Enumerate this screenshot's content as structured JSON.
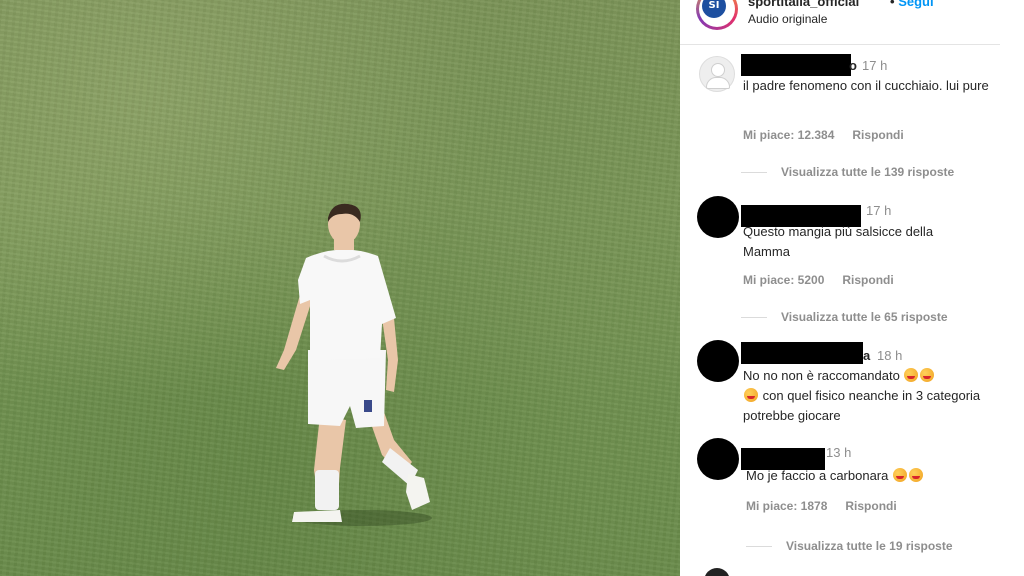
{
  "header": {
    "username": "sportitalia_official",
    "separator": "•",
    "follow_label": "Segui",
    "audio_label": "Audio originale",
    "logo_text": "SI"
  },
  "comments": [
    {
      "name_tail": "o",
      "time": "17 h",
      "text": "il padre fenomeno con il cucchiaio. lui pure",
      "likes": "Mi piace: 12.384",
      "reply_label": "Rispondi",
      "view_replies": "Visualizza tutte le 139 risposte"
    },
    {
      "name_tail": "",
      "time": "17 h",
      "text": "Questo mangia più salsicce della Mamma",
      "likes": "Mi piace: 5200",
      "reply_label": "Rispondi",
      "view_replies": "Visualizza tutte le 65 risposte"
    },
    {
      "name_tail": "a",
      "time": "18 h",
      "text_a": "No no non è raccomandato",
      "text_b": "con quel fisico neanche in 3 categoria potrebbe giocare"
    },
    {
      "name_tail": "",
      "time": "13 h",
      "text": "Mo je faccio a carbonara",
      "likes": "Mi piace: 1878",
      "reply_label": "Rispondi",
      "view_replies": "Visualizza tutte le 19 risposte"
    }
  ],
  "colors": {
    "follow": "#0095f6",
    "muted": "#8e8e8e",
    "text": "#262626"
  },
  "icons": [
    "default-avatar-icon",
    "laughing-emoji-icon",
    "like-heart-icon"
  ]
}
